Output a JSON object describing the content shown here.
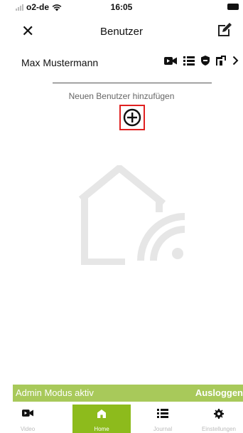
{
  "status_bar": {
    "carrier": "o2-de",
    "time": "16:05"
  },
  "nav": {
    "title": "Benutzer",
    "close_icon": "close-icon",
    "edit_icon": "edit-icon"
  },
  "user_row": {
    "name": "Max Mustermann",
    "icons": [
      "video-camera-icon",
      "list-icon",
      "shield-icon",
      "door-icon",
      "chevron-right-icon"
    ]
  },
  "add_user": {
    "label": "Neuen Benutzer hinzufügen",
    "icon": "plus-circle-icon"
  },
  "admin_bar": {
    "mode_text": "Admin Modus aktiv",
    "logout_label": "Ausloggen",
    "color": "#a8c95a"
  },
  "tabs": [
    {
      "label": "Video",
      "icon": "video-camera-icon",
      "active": false
    },
    {
      "label": "Home",
      "icon": "home-icon",
      "active": true
    },
    {
      "label": "Journal",
      "icon": "list-icon",
      "active": false
    },
    {
      "label": "Einstellungen",
      "icon": "gear-icon",
      "active": false
    }
  ],
  "colors": {
    "accent": "#8dbb1c",
    "highlight": "#e02020"
  }
}
